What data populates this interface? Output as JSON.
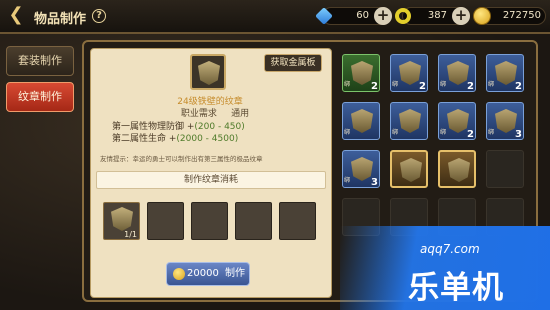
{
  "header": {
    "title": "物品制作",
    "back_icon": "back-arrow-icon",
    "help_icon": "help-icon"
  },
  "currencies": [
    {
      "icon": "gem-icon",
      "value": "60"
    },
    {
      "icon": "ring-icon",
      "value": "387"
    },
    {
      "icon": "gold-coin-icon",
      "value": "272750"
    }
  ],
  "tabs": [
    {
      "label": "套装制作",
      "active": false
    },
    {
      "label": "纹章制作",
      "active": true
    }
  ],
  "craft": {
    "get_metal_label": "获取金属板",
    "item_name": "24级铁壁的纹章",
    "job_req_label": "职业需求",
    "job_req_value": "通用",
    "attr1_label": "第一属性物理防御 +",
    "attr1_value": "(200 - 450)",
    "attr2_label": "第二属性生命 +",
    "attr2_value": "(2000 - 4500)",
    "tip": "友情提示：幸运的勇士可以制作出有第三属性的极品纹章",
    "cost_title": "制作纹章消耗",
    "materials": [
      {
        "count": "1/1",
        "filled": true
      },
      {
        "count": "",
        "filled": false
      },
      {
        "count": "",
        "filled": false
      },
      {
        "count": "",
        "filled": false
      },
      {
        "count": "",
        "filled": false
      }
    ],
    "craft_cost": "20000",
    "craft_label": "制作"
  },
  "inventory": [
    {
      "type": "green",
      "lock": "绑",
      "count": "2"
    },
    {
      "type": "blue",
      "lock": "绑",
      "count": "2"
    },
    {
      "type": "blue",
      "lock": "绑",
      "count": "2"
    },
    {
      "type": "blue",
      "lock": "绑",
      "count": "2"
    },
    {
      "type": "blue",
      "lock": "绑",
      "count": ""
    },
    {
      "type": "blue",
      "lock": "绑",
      "count": ""
    },
    {
      "type": "blue",
      "lock": "绑",
      "count": "2"
    },
    {
      "type": "blue",
      "lock": "绑",
      "count": "3"
    },
    {
      "type": "blue",
      "lock": "绑",
      "count": "3"
    },
    {
      "type": "gold",
      "lock": "",
      "count": ""
    },
    {
      "type": "gold",
      "lock": "",
      "count": ""
    },
    {
      "type": "empty",
      "lock": "",
      "count": ""
    },
    {
      "type": "empty",
      "lock": "",
      "count": ""
    },
    {
      "type": "empty",
      "lock": "",
      "count": ""
    },
    {
      "type": "empty",
      "lock": "",
      "count": ""
    },
    {
      "type": "empty",
      "lock": "",
      "count": ""
    }
  ],
  "watermark": {
    "url": "aqq7.com",
    "brand": "乐单机"
  }
}
